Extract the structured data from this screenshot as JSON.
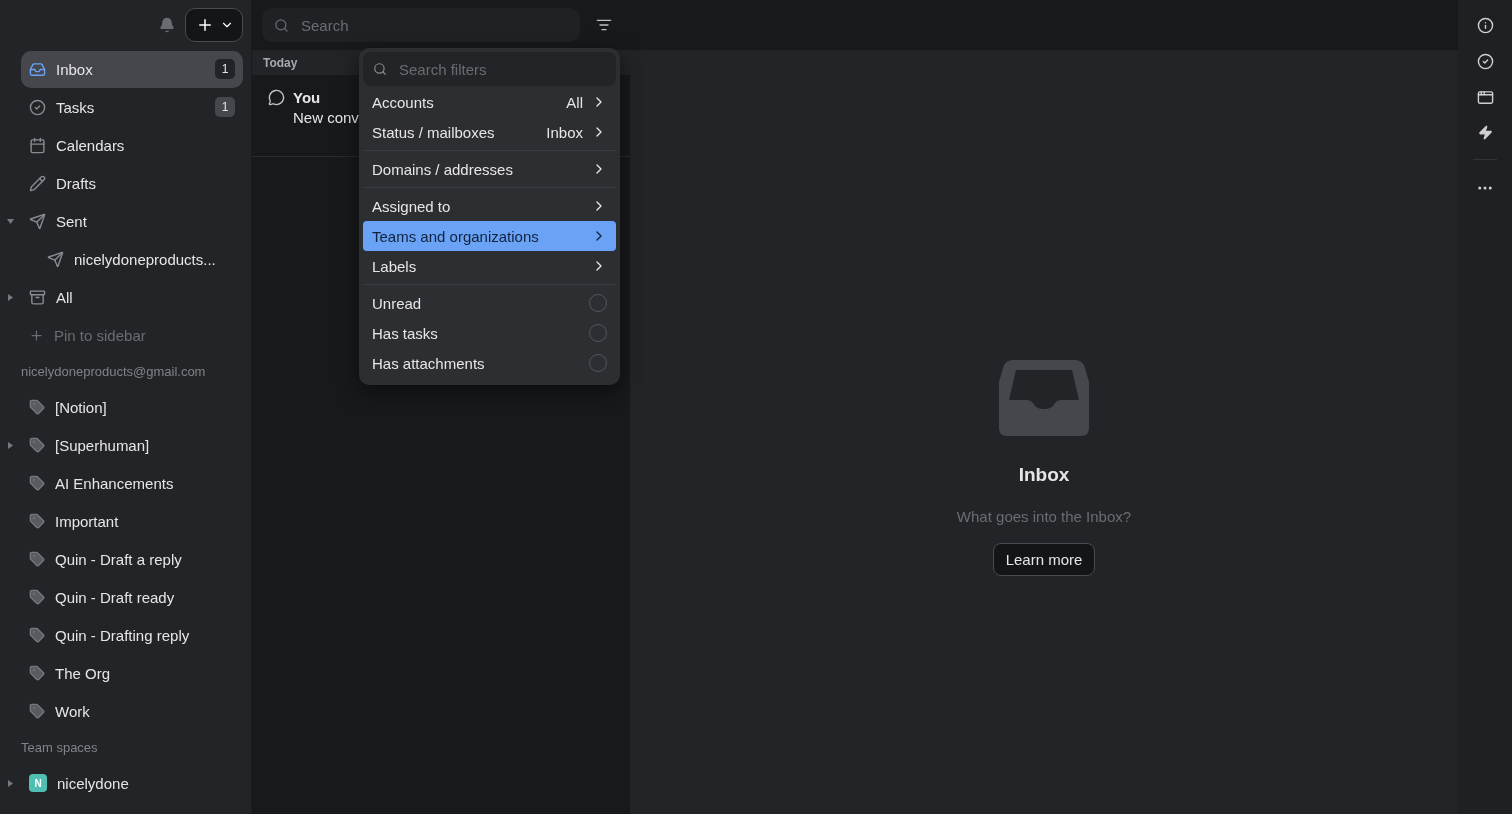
{
  "sidebar": {
    "nav": [
      {
        "label": "Inbox",
        "badge": "1",
        "selected": true
      },
      {
        "label": "Tasks",
        "badge": "1",
        "selected": false
      },
      {
        "label": "Calendars",
        "selected": false
      },
      {
        "label": "Drafts",
        "selected": false
      },
      {
        "label": "Sent",
        "selected": false,
        "expanded": true,
        "children": [
          {
            "label": "nicelydoneproducts...",
            "selected": false
          }
        ]
      },
      {
        "label": "All",
        "selected": false,
        "expanded": false
      }
    ],
    "pin_label": "Pin to sidebar",
    "account": "nicelydoneproducts@gmail.com",
    "labels": [
      {
        "label": "[Notion]"
      },
      {
        "label": "[Superhuman]",
        "expanded": false
      },
      {
        "label": "AI Enhancements"
      },
      {
        "label": "Important"
      },
      {
        "label": "Quin - Draft a reply"
      },
      {
        "label": "Quin - Draft ready"
      },
      {
        "label": "Quin - Drafting reply"
      },
      {
        "label": "The Org"
      },
      {
        "label": "Work"
      }
    ],
    "team_heading": "Team spaces",
    "teams": [
      {
        "initial": "N",
        "label": "nicelydone",
        "color": "#4fbfb3",
        "expanded": false
      }
    ]
  },
  "search": {
    "placeholder": "Search"
  },
  "list": {
    "section": "Today",
    "rows": [
      {
        "sender": "You",
        "preview": "New conv"
      }
    ]
  },
  "filter_menu": {
    "placeholder": "Search filters",
    "groups": [
      [
        {
          "kind": "submenu",
          "label": "Accounts",
          "value": "All",
          "selected": false
        },
        {
          "kind": "submenu",
          "label": "Status / mailboxes",
          "value": "Inbox",
          "selected": false
        }
      ],
      [
        {
          "kind": "submenu",
          "label": "Domains / addresses",
          "selected": false
        }
      ],
      [
        {
          "kind": "submenu",
          "label": "Assigned to",
          "selected": false
        },
        {
          "kind": "submenu",
          "label": "Teams and organizations",
          "selected": true
        },
        {
          "kind": "submenu",
          "label": "Labels",
          "selected": false
        }
      ],
      [
        {
          "kind": "checkbox",
          "label": "Unread",
          "checked": false
        },
        {
          "kind": "checkbox",
          "label": "Has tasks",
          "checked": false
        },
        {
          "kind": "checkbox",
          "label": "Has attachments",
          "checked": false
        }
      ]
    ]
  },
  "empty_state": {
    "title": "Inbox",
    "subtitle": "What goes into the Inbox?",
    "button": "Learn more"
  }
}
